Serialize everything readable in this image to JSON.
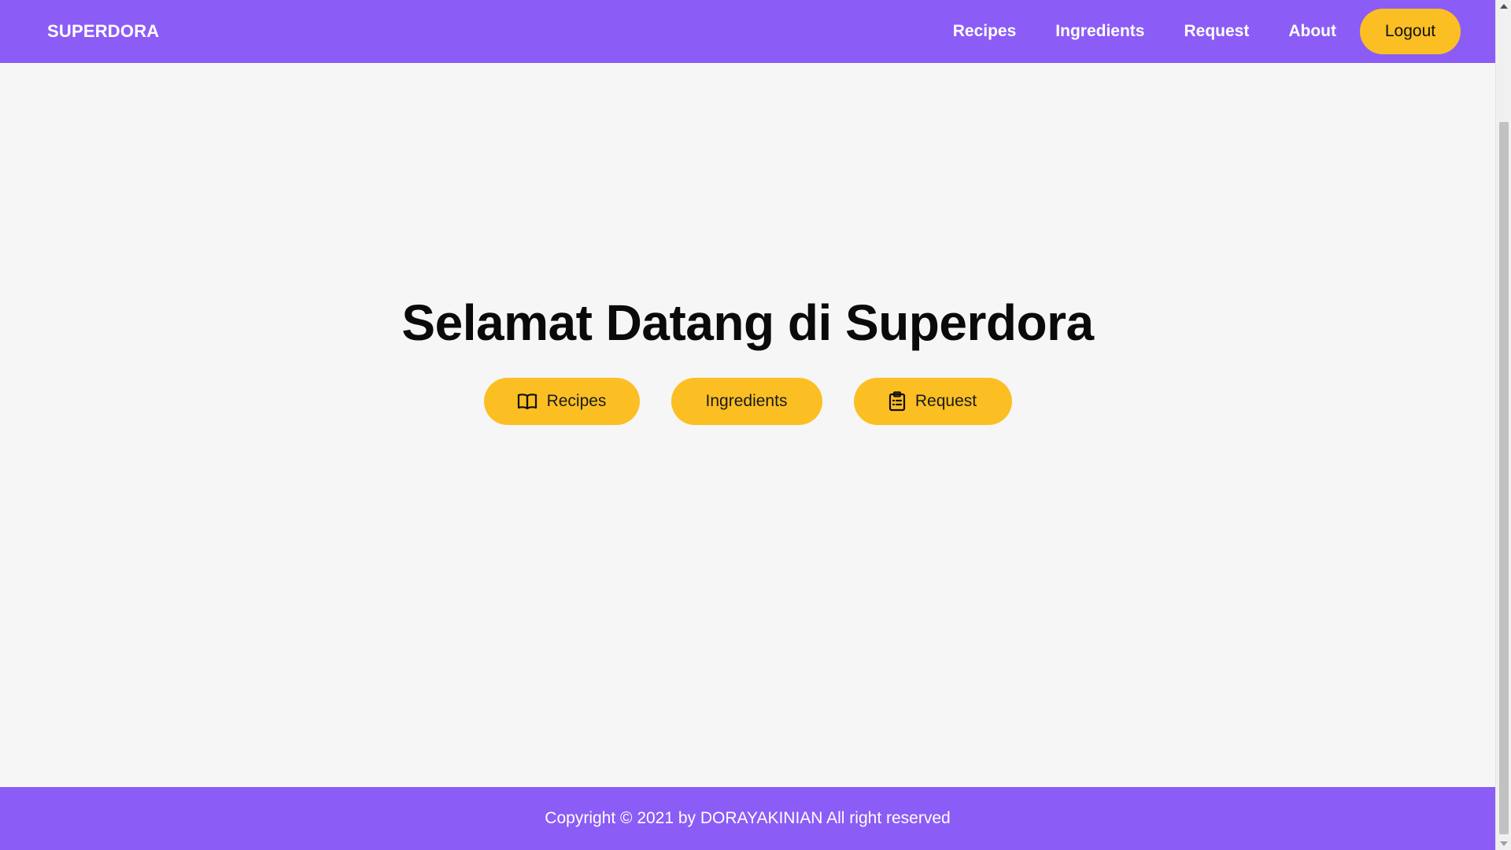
{
  "colors": {
    "primary": "#8b5cf6",
    "accent": "#fbbf24",
    "background": "#f6f6f6",
    "text_dark": "#0a0a0a",
    "text_light": "#ffffff"
  },
  "navbar": {
    "brand": "SUPERDORA",
    "links": [
      {
        "label": "Recipes"
      },
      {
        "label": "Ingredients"
      },
      {
        "label": "Request"
      },
      {
        "label": "About"
      }
    ],
    "logout_label": "Logout"
  },
  "hero": {
    "title": "Selamat Datang di Superdora",
    "buttons": [
      {
        "label": "Recipes",
        "icon": "book-open-icon"
      },
      {
        "label": "Ingredients",
        "icon": ""
      },
      {
        "label": "Request",
        "icon": "clipboard-list-icon"
      }
    ]
  },
  "footer": {
    "text": "Copyright © 2021 by DORAYAKINIAN All right reserved"
  }
}
